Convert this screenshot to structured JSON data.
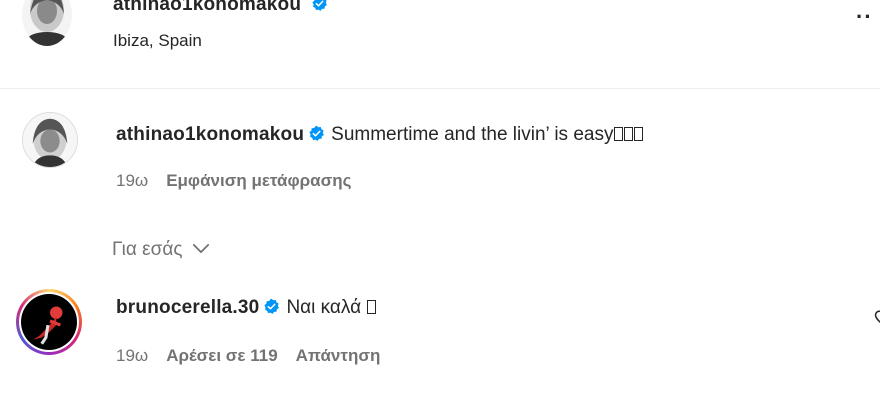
{
  "post_header": {
    "username": "athinao1konomakou",
    "location": "Ibiza, Spain",
    "more_label": "··"
  },
  "caption": {
    "username": "athinao1konomakou",
    "text": "Summertime and the livin’ is easy",
    "emoji_placeholders": 3,
    "time": "19ω",
    "translate_label": "Εμφάνιση μετάφρασης"
  },
  "filter": {
    "label": "Για εσάς"
  },
  "comment": {
    "username": "brunocerella.30",
    "text": "Ναι καλά",
    "emoji_placeholders": 1,
    "time": "19ω",
    "likes_label": "Αρέσει σε 119",
    "reply_label": "Απάντηση"
  },
  "colors": {
    "verified": "#0095f6",
    "text": "#262626",
    "muted": "#737373",
    "story_ring": [
      "#feda75",
      "#fa7e1e",
      "#d62976",
      "#962fbf",
      "#4f5bd5"
    ]
  }
}
